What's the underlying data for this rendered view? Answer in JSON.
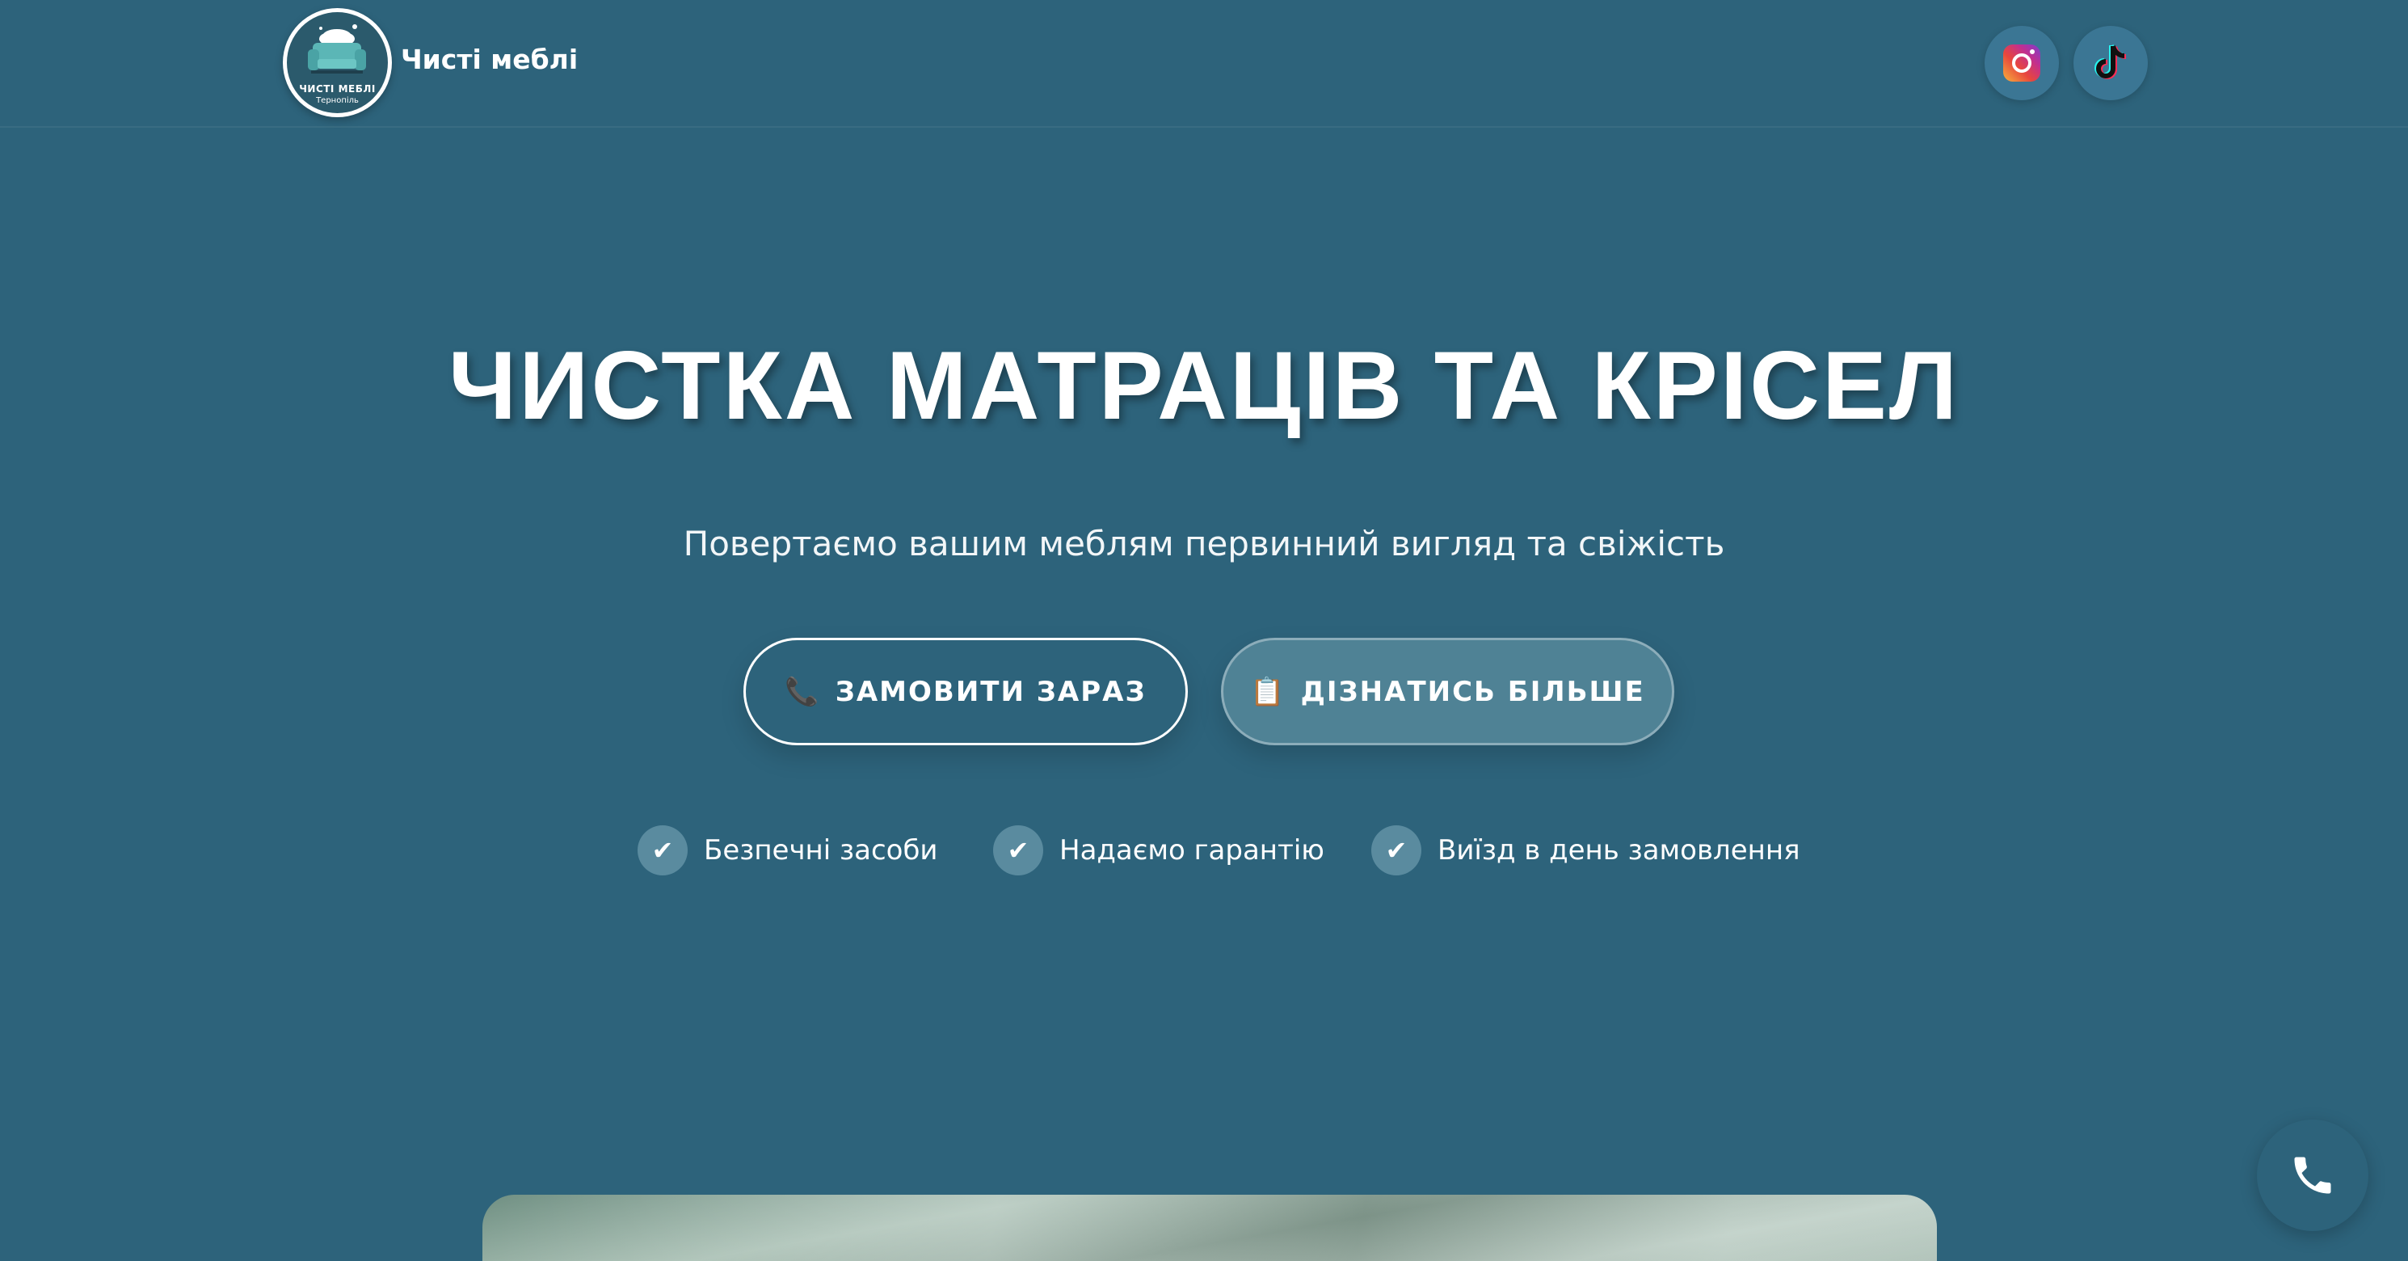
{
  "header": {
    "logo": {
      "line1": "ЧИСТІ МЕБЛІ",
      "line2": "Тернопіль"
    },
    "brand": "Чисті меблі",
    "social": [
      {
        "name": "instagram",
        "icon": "instagram-icon"
      },
      {
        "name": "tiktok",
        "icon": "tiktok-icon"
      }
    ]
  },
  "hero": {
    "title": "ЧИСТКА МАТРАЦІВ ТА КРІСЕЛ",
    "subtitle": "Повертаємо вашим меблям первинний вигляд та свіжість",
    "buttons": {
      "order": {
        "icon": "📞",
        "label": "ЗАМОВИТИ ЗАРАЗ"
      },
      "more": {
        "icon": "📋",
        "label": "ДІЗНАТИСЬ БІЛЬШЕ"
      }
    },
    "features": [
      {
        "icon": "✔",
        "label": "Безпечні засоби"
      },
      {
        "icon": "✔",
        "label": "Надаємо гарантію"
      },
      {
        "icon": "✔",
        "label": "Виїзд в день замовлення"
      }
    ]
  },
  "colors": {
    "background": "#2d637b",
    "button_secondary": "#4f8295",
    "check_circle": "#5a8b9f"
  },
  "floating": {
    "icon": "phone-icon"
  }
}
